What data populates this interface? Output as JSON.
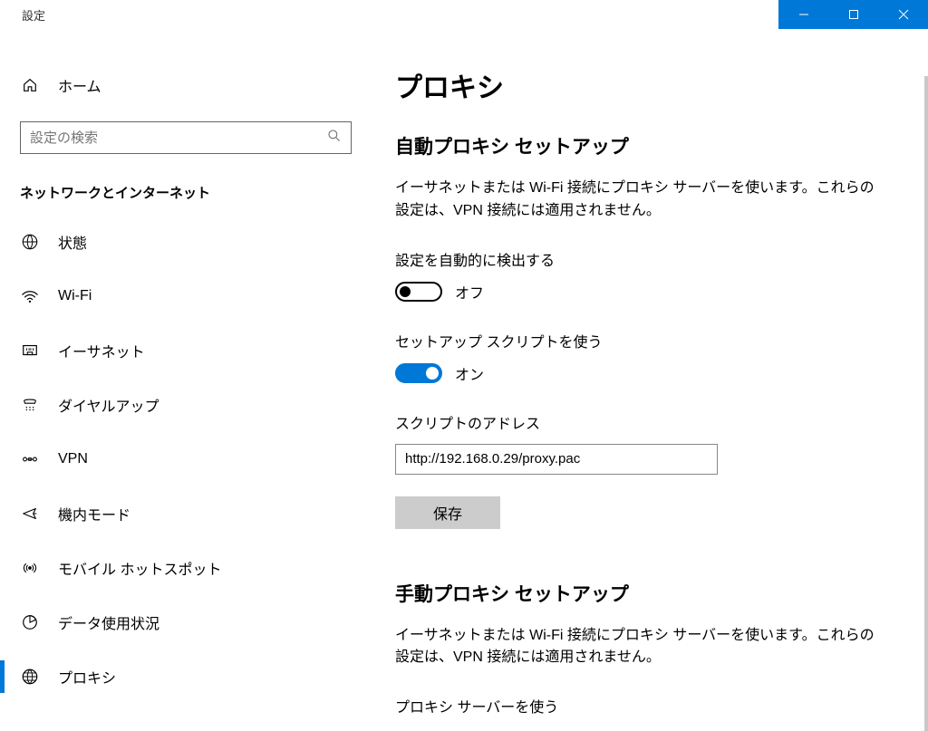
{
  "window": {
    "title": "設定"
  },
  "sidebar": {
    "home_label": "ホーム",
    "search_placeholder": "設定の検索",
    "section_header": "ネットワークとインターネット",
    "items": [
      {
        "label": "状態",
        "icon": "status-icon"
      },
      {
        "label": "Wi-Fi",
        "icon": "wifi-icon"
      },
      {
        "label": "イーサネット",
        "icon": "ethernet-icon"
      },
      {
        "label": "ダイヤルアップ",
        "icon": "dialup-icon"
      },
      {
        "label": "VPN",
        "icon": "vpn-icon"
      },
      {
        "label": "機内モード",
        "icon": "airplane-icon"
      },
      {
        "label": "モバイル ホットスポット",
        "icon": "hotspot-icon"
      },
      {
        "label": "データ使用状況",
        "icon": "data-usage-icon"
      },
      {
        "label": "プロキシ",
        "icon": "proxy-icon"
      }
    ],
    "selected_index": 8
  },
  "main": {
    "page_title": "プロキシ",
    "auto_section": {
      "heading": "自動プロキシ セットアップ",
      "description": "イーサネットまたは Wi-Fi 接続にプロキシ サーバーを使います。これらの設定は、VPN 接続には適用されません。",
      "auto_detect_label": "設定を自動的に検出する",
      "auto_detect_state": "オフ",
      "use_script_label": "セットアップ スクリプトを使う",
      "use_script_state": "オン",
      "script_address_label": "スクリプトのアドレス",
      "script_address_value": "http://192.168.0.29/proxy.pac",
      "save_button": "保存"
    },
    "manual_section": {
      "heading": "手動プロキシ セットアップ",
      "description": "イーサネットまたは Wi-Fi 接続にプロキシ サーバーを使います。これらの設定は、VPN 接続には適用されません。",
      "use_proxy_label": "プロキシ サーバーを使う"
    }
  }
}
